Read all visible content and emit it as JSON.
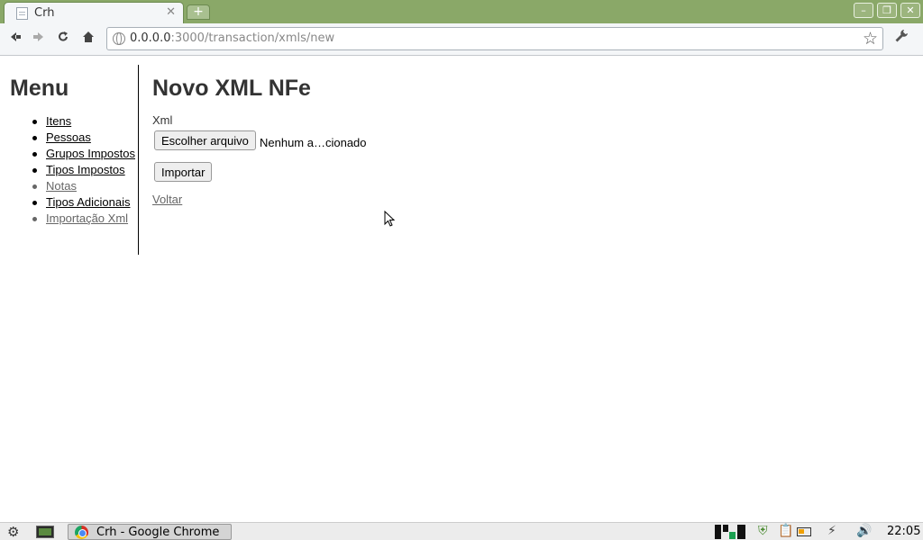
{
  "browser": {
    "tab_title": "Crh",
    "tab_close_glyph": "✕",
    "new_tab_glyph": "+",
    "url_host": "0.0.0.0",
    "url_path": ":3000/transaction/xmls/new",
    "window_buttons": {
      "minimize": "–",
      "maximize": "❐",
      "close": "✕"
    },
    "icons": [
      "page-icon",
      "back-icon",
      "forward-icon",
      "reload-icon",
      "home-icon",
      "globe-icon",
      "star-icon",
      "wrench-icon"
    ]
  },
  "sidebar": {
    "title": "Menu",
    "items": [
      {
        "label": "Itens",
        "visited": false
      },
      {
        "label": "Pessoas",
        "visited": false
      },
      {
        "label": "Grupos Impostos",
        "visited": false
      },
      {
        "label": "Tipos Impostos",
        "visited": false
      },
      {
        "label": "Notas",
        "visited": true
      },
      {
        "label": "Tipos Adicionais",
        "visited": false
      },
      {
        "label": "Importação Xml",
        "visited": true
      }
    ]
  },
  "main": {
    "title": "Novo XML NFe",
    "xml_label": "Xml",
    "file_button": "Escolher arquivo",
    "file_status": "Nenhum a…cionado",
    "import_button": "Importar",
    "back_link": "Voltar"
  },
  "taskbar": {
    "task_label": "Crh - Google Chrome",
    "clock": "22:05",
    "icons": [
      "gear-icon",
      "desktop-icon",
      "chrome-icon",
      "workspace-icon",
      "shield-icon",
      "clipboard-icon",
      "battery-icon",
      "network-icon",
      "volume-icon"
    ]
  },
  "colors": {
    "titlebar": "#8aa868",
    "toolbar": "#f4f6f8",
    "heading": "#333333",
    "visited_link": "#666666"
  }
}
